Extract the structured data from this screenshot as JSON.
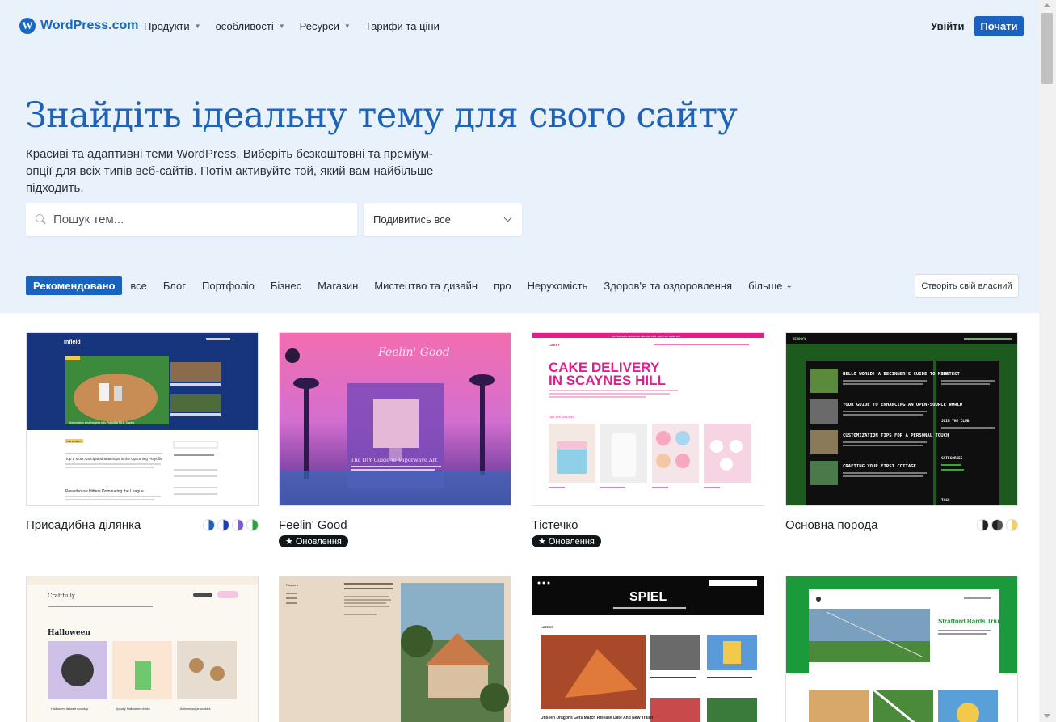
{
  "header": {
    "logo_text": "WordPress.com",
    "menu": [
      {
        "label": "Продукти",
        "has_caret": true
      },
      {
        "label": "особливості",
        "has_caret": true
      },
      {
        "label": "Ресурси",
        "has_caret": true
      },
      {
        "label": "Тарифи та ціни",
        "has_caret": false
      }
    ],
    "login_label": "Увійти",
    "start_label": "Почати"
  },
  "hero": {
    "title": "Знайдіть ідеальну тему для свого сайту",
    "subtitle": "Красиві та адаптивні теми WordPress. Виберіть безкоштовні та преміум-опції для всіх типів веб-сайтів. Потім активуйте той, який вам найбільше підходить."
  },
  "search": {
    "placeholder": "Пошук тем...",
    "value": ""
  },
  "filter": {
    "selected": "Подивитись все"
  },
  "categories": [
    {
      "label": "Рекомендовано",
      "active": true
    },
    {
      "label": "все",
      "active": false
    },
    {
      "label": "Блог",
      "active": false
    },
    {
      "label": "Портфоліо",
      "active": false
    },
    {
      "label": "Бізнес",
      "active": false
    },
    {
      "label": "Магазин",
      "active": false
    },
    {
      "label": "Мистецтво та дизайн",
      "active": false
    },
    {
      "label": "про",
      "active": false
    },
    {
      "label": "Нерухомість",
      "active": false
    },
    {
      "label": "Здоров'я та оздоровлення",
      "active": false
    }
  ],
  "more_label": "більше",
  "create_label": "Створіть свій власний",
  "badge_label": "Оновлення",
  "themes": [
    {
      "name": "Присадибна ділянка",
      "updated": false,
      "style_colors": [
        "#1a62c0",
        "#1d3fbf",
        "#7b5cd6",
        "#2aa33d"
      ]
    },
    {
      "name": "Feelin' Good",
      "updated": true,
      "style_colors": []
    },
    {
      "name": "Тістечко",
      "updated": true,
      "style_colors": []
    },
    {
      "name": "Основна порода",
      "updated": false,
      "style_colors": [
        "#222222",
        "#555555",
        "#f2d15a"
      ]
    }
  ],
  "previews": {
    "infield": {
      "brand": "Infield",
      "feature": "Speculation and Insights into Potential MLB Trades",
      "latest_tag": "THE LATEST",
      "post1": "Top 5 Most Anticipated Matchups in the Upcoming Playoffs",
      "post2": "Powerhouse Hitters Dominating the League"
    },
    "feelin": {
      "script": "Feelin' Good",
      "caption": "The DIY Guide to Vaporwave Art"
    },
    "cake": {
      "top_banner": "ALL ORDERS RECEIVED BEFORE 2PM SHIP THE SAME DAY",
      "brand": "CAKEY",
      "headline_1": "CAKE DELIVERY",
      "headline_2": "IN SCAYNES HILL",
      "section": "OUR SPECIALITIES"
    },
    "bedrock": {
      "brand": "BEDROCK",
      "posts": [
        "HELLO WORLD! A BEGINNER'S GUIDE TO MINETEST",
        "YOUR GUIDE TO ENHANCING AN OPEN-SOURCE WORLD",
        "CUSTOMIZATION TIPS FOR A PERSONAL TOUCH",
        "CRAFTING YOUR FIRST COTTAGE"
      ],
      "sidebar": [
        "HEY!",
        "JOIN THE CLUB",
        "CATEGORIES",
        "TAGS"
      ]
    },
    "craftfully": {
      "brand": "Craftfully",
      "section": "Halloween",
      "items": [
        "Halloween dessert roundup",
        "Spooky Halloween drinks",
        "Autumn sugar cookies"
      ]
    },
    "painting": {
      "brand": "Pissarro"
    },
    "spiel": {
      "brand": "SPIEL",
      "label": "LATEST",
      "headline": "Unseen Dragons Gets March Release Date And New Trailer"
    },
    "sports": {
      "headline": "Stratford Bards Triumph in Sonnet Park"
    }
  }
}
